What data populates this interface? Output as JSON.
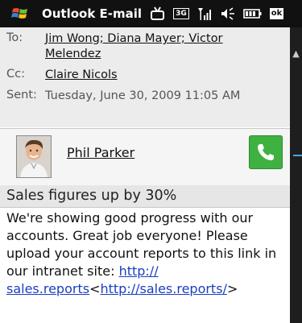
{
  "status_bar": {
    "app_title": "Outlook E-mail",
    "network_badge": "3G",
    "ok_label": "ok",
    "icons": [
      "windows-start-icon",
      "notification-icon",
      "network-3g-icon",
      "signal-icon",
      "volume-icon",
      "battery-icon",
      "ok-icon"
    ]
  },
  "headers": {
    "to_label": "To:",
    "to_value": "Jim Wong; Diana Mayer; Victor Melendez",
    "cc_label": "Cc:",
    "cc_value": "Claire Nicols",
    "sent_label": "Sent:",
    "sent_value": "Tuesday, June 30, 2009 11:05 AM"
  },
  "sender": {
    "name": "Phil Parker",
    "call_icon": "phone-icon"
  },
  "subject": "Sales figures up by 30%",
  "body": {
    "text": "We're showing good progress with our accounts. Great job everyone! Please upload your account reports to this link in our intranet site: ",
    "link1": "http://\nsales.reports",
    "link_sep_left": "<",
    "link2": "http://sales.reports/",
    "link_sep_right": ">"
  },
  "colors": {
    "status_bar_bg": "#111111",
    "header_bg": "#ececec",
    "call_button": "#3fb141",
    "link": "#1a3fc0"
  }
}
